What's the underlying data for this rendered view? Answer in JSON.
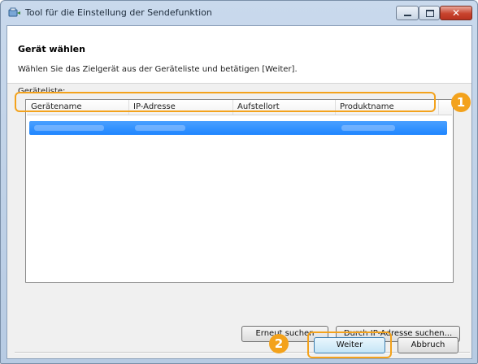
{
  "window": {
    "title": "Tool für die Einstellung der Sendefunktion",
    "close_glyph": "✕"
  },
  "page": {
    "section_title": "Gerät wählen",
    "instruction": "Wählen Sie das Zielgerät aus der Geräteliste und betätigen [Weiter].",
    "list_label": "Geräteliste:"
  },
  "device_list": {
    "columns": [
      "Gerätename",
      "IP-Adresse",
      "Aufstellort",
      "Produktname"
    ],
    "selected_row_blurred": true
  },
  "buttons": {
    "rescan": "Erneut suchen",
    "search_by_ip": "Durch IP-Adresse suchen...",
    "next": "Weiter",
    "cancel": "Abbruch"
  },
  "callouts": {
    "step1": "1",
    "step2": "2",
    "accent_color": "#f3a21c"
  },
  "colors": {
    "selection": "#1f86ff",
    "titlebar": "#c9d9ec",
    "close_button": "#c8432d"
  }
}
